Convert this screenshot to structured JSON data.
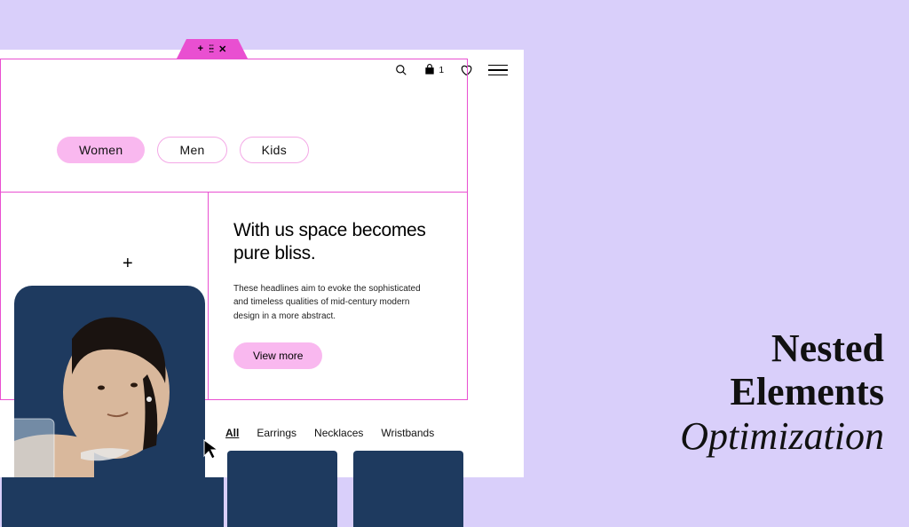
{
  "editor": {
    "add_icon": "+",
    "drag_icon": "⠿",
    "close_icon": "✕"
  },
  "top_nav": {
    "cart_count": "1"
  },
  "categories": [
    {
      "label": "Women",
      "active": true
    },
    {
      "label": "Men",
      "active": false
    },
    {
      "label": "Kids",
      "active": false
    }
  ],
  "hero": {
    "headline": "With us space becomes pure bliss.",
    "body": "These headlines aim to evoke the sophisticated and timeless qualities of mid-century modern design in a more abstract.",
    "cta": "View more"
  },
  "add_block_icon": "+",
  "subcategories": [
    {
      "label": "All",
      "active": true
    },
    {
      "label": "Earrings",
      "active": false
    },
    {
      "label": "Necklaces",
      "active": false
    },
    {
      "label": "Wristbands",
      "active": false
    }
  ],
  "promo": {
    "line1": "Nested",
    "line2": "Elements",
    "line3": "Optimization"
  }
}
